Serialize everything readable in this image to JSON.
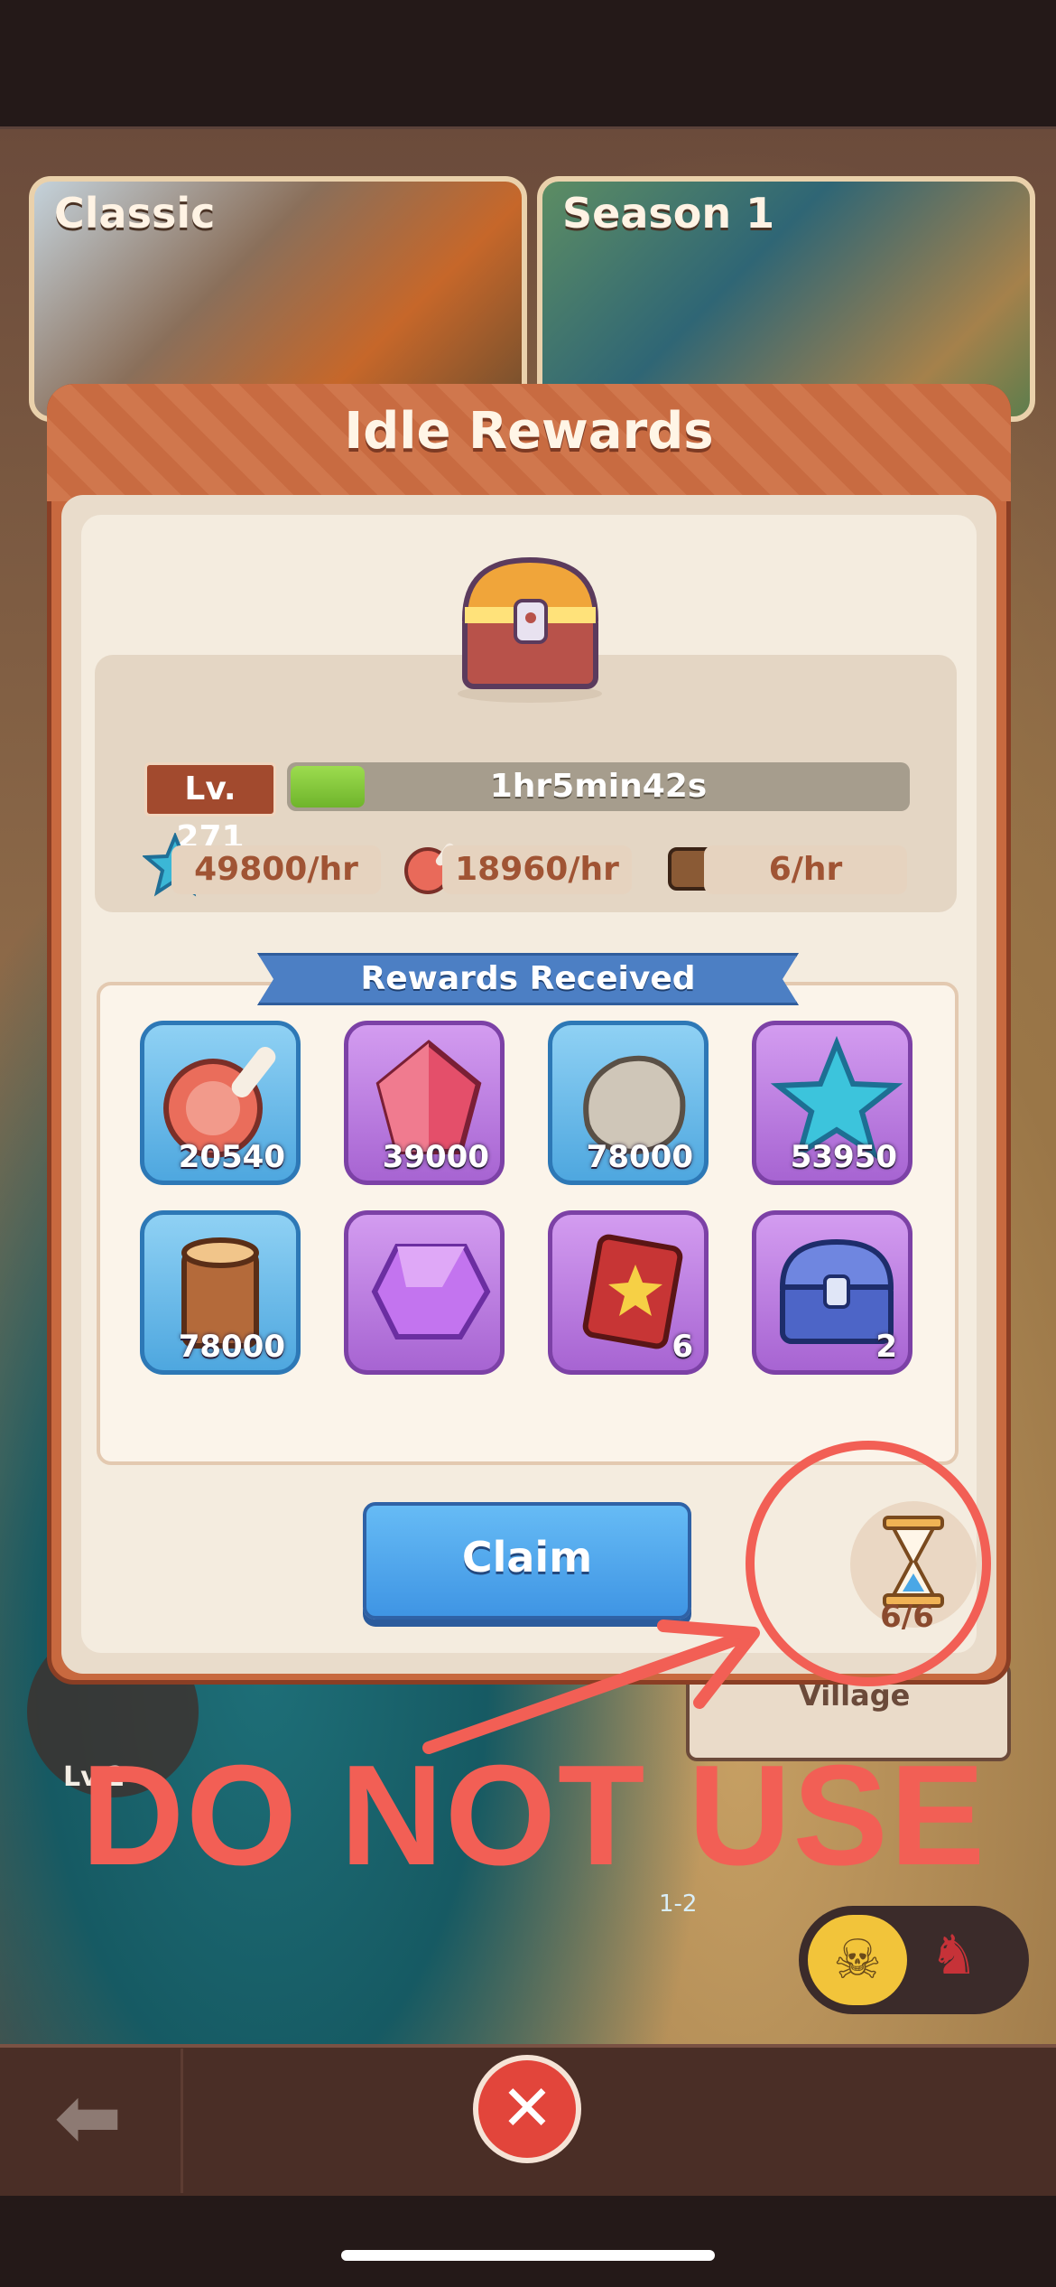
{
  "map": {
    "cards": [
      {
        "title": "Classic"
      },
      {
        "title": "Season 1"
      }
    ],
    "village_label": "Village",
    "lv_label": "Lv.2",
    "stage_label": "1-2"
  },
  "dialog": {
    "title": "Idle Rewards",
    "level": "Lv. 271",
    "timer": "1hr5min42s",
    "timer_progress": 0.12,
    "rates": [
      {
        "icon": "star-icon",
        "value": "49800/hr"
      },
      {
        "icon": "meat-icon",
        "value": "18960/hr"
      },
      {
        "icon": "mystery-chest-icon",
        "value": "6/hr"
      }
    ],
    "rewards_header": "Rewards Received",
    "rewards": [
      {
        "icon": "meat-icon",
        "qty": "20540",
        "rarity": "blue"
      },
      {
        "icon": "ruby-icon",
        "qty": "39000",
        "rarity": "purple"
      },
      {
        "icon": "stone-icon",
        "qty": "78000",
        "rarity": "blue"
      },
      {
        "icon": "star-icon",
        "qty": "53950",
        "rarity": "purple"
      },
      {
        "icon": "wood-icon",
        "qty": "78000",
        "rarity": "blue"
      },
      {
        "icon": "purple-crystal-icon",
        "qty": "",
        "rarity": "purple"
      },
      {
        "icon": "spellbook-icon",
        "qty": "6",
        "rarity": "purple"
      },
      {
        "icon": "blue-chest-icon",
        "qty": "2",
        "rarity": "purple"
      }
    ],
    "claim_label": "Claim",
    "hourglass_count": "6/6"
  },
  "annotation": {
    "warning_text": "DO NOT USE",
    "color": "#f25f55"
  },
  "nav": {
    "back_icon": "back-arrow-icon",
    "close_icon": "close-icon"
  }
}
